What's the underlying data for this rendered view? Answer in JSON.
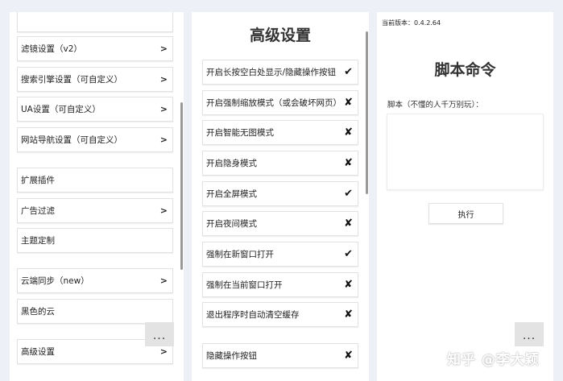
{
  "left_panel": {
    "items": [
      {
        "label": "滤镜设置（v2）",
        "chevron": ">"
      },
      {
        "label": "搜索引擎设置（可自定义）",
        "chevron": ">"
      },
      {
        "label": "UA设置（可自定义）",
        "chevron": ">"
      },
      {
        "label": "网站导航设置（可自定义）",
        "chevron": ">"
      },
      {
        "label": "扩展插件",
        "chevron": ""
      },
      {
        "label": "广告过滤",
        "chevron": ">"
      },
      {
        "label": "主题定制",
        "chevron": ""
      },
      {
        "label": "云端同步（new）",
        "chevron": ">"
      },
      {
        "label": "黑色的云",
        "chevron": ""
      },
      {
        "label": "高级设置",
        "chevron": ">"
      }
    ],
    "more_label": "..."
  },
  "middle_panel": {
    "title": "高级设置",
    "items": [
      {
        "label": "开启长按空白处显示/隐藏操作按钮",
        "mark": "✔"
      },
      {
        "label": "开启强制缩放模式（或会破坏网页）",
        "mark": "✘"
      },
      {
        "label": "开启智能无图模式",
        "mark": "✘"
      },
      {
        "label": "开启隐身模式",
        "mark": "✘"
      },
      {
        "label": "开启全屏模式",
        "mark": "✔"
      },
      {
        "label": "开启夜间模式",
        "mark": "✘"
      },
      {
        "label": "强制在新窗口打开",
        "mark": "✔"
      },
      {
        "label": "强制在当前窗口打开",
        "mark": "✘"
      },
      {
        "label": "退出程序时自动清空缓存",
        "mark": "✘"
      },
      {
        "label": "隐藏操作按钮",
        "mark": "✘"
      }
    ]
  },
  "right_panel": {
    "version": "当前版本：0.4.2.64",
    "title": "脚本命令",
    "script_label": "脚本（不懂的人千万别玩）：",
    "script_value": "",
    "execute_label": "执行",
    "more_label": "..."
  },
  "watermark": "知乎 @李大颖"
}
